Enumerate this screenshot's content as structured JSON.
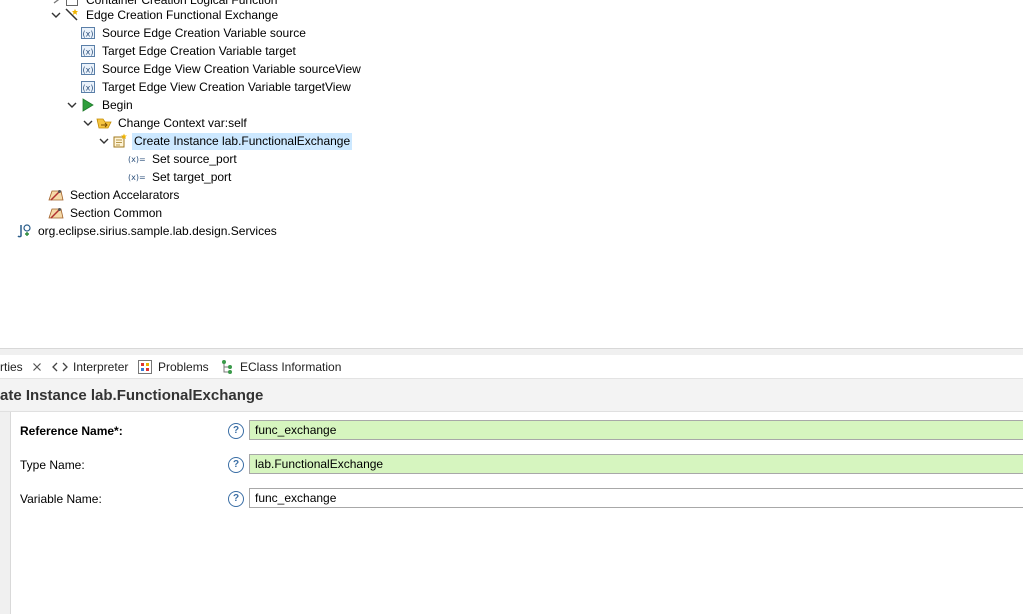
{
  "tree": {
    "partial_top": "Container Creation Logical Function",
    "edge_creation": "Edge Creation Functional Exchange",
    "var_source": "Source Edge Creation Variable source",
    "var_target": "Target Edge Creation Variable target",
    "var_source_view": "Source Edge View Creation Variable sourceView",
    "var_target_view": "Target Edge View Creation Variable targetView",
    "begin": "Begin",
    "change_context": "Change Context var:self",
    "create_instance": "Create Instance lab.FunctionalExchange",
    "set_source": "Set source_port",
    "set_target": "Set target_port",
    "section_accelerators": "Section Accelarators",
    "section_common": "Section Common",
    "java_extension": "org.eclipse.sirius.sample.lab.design.Services"
  },
  "tabs": {
    "properties": "rties",
    "interpreter": "Interpreter",
    "problems": "Problems",
    "eclass": "EClass Information"
  },
  "properties": {
    "title": "ate Instance lab.FunctionalExchange",
    "fields": [
      {
        "label": "Reference Name*:",
        "value": "func_exchange",
        "help": "?"
      },
      {
        "label": "Type Name:",
        "value": "lab.FunctionalExchange",
        "help": "?"
      },
      {
        "label": "Variable Name:",
        "value": "func_exchange",
        "help": "?"
      }
    ]
  },
  "colors": {
    "selection": "#cce8ff",
    "required_field": "#d6f5bf",
    "begin_triangle": "#2e9e3c"
  }
}
